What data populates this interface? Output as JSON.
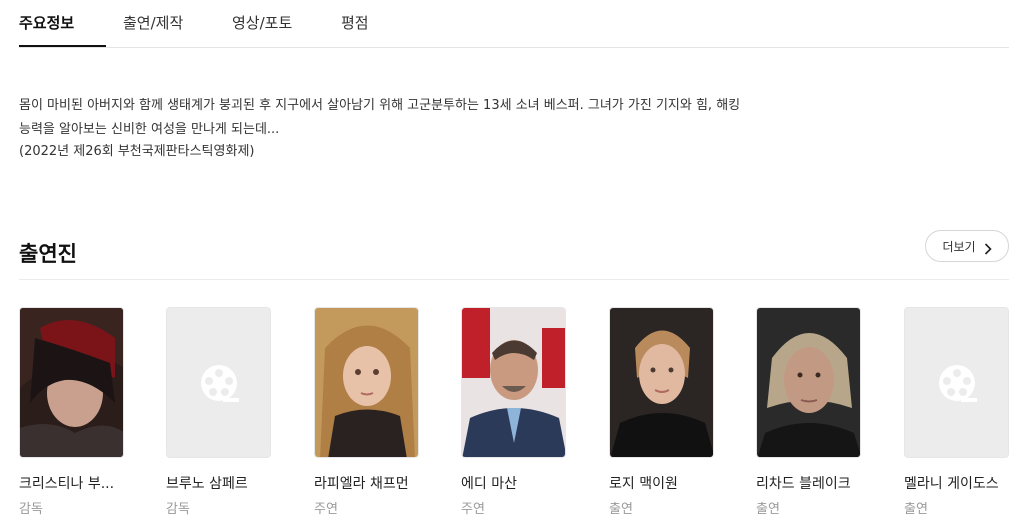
{
  "tabs": [
    {
      "label": "주요정보"
    },
    {
      "label": "출연/제작"
    },
    {
      "label": "영상/포토"
    },
    {
      "label": "평점"
    }
  ],
  "synopsis": {
    "text": "몸이 마비된 아버지와 함께 생태계가 붕괴된 후 지구에서 살아남기 위해 고군분투하는 13세 소녀 베스퍼. 그녀가 가진 기지와 힘, 해킹 능력을 알아보는 신비한 여성을 만나게 되는데...",
    "festival": "(2022년 제26회 부천국제판타스틱영화제)"
  },
  "cast_section": {
    "title": "출연진",
    "more_label": "더보기"
  },
  "cast": [
    {
      "name": "크리스티나 부...",
      "role": "감독",
      "photo": "person-photo"
    },
    {
      "name": "브루노 삼페르",
      "role": "감독",
      "photo": "placeholder-film-icon"
    },
    {
      "name": "라피엘라 채프먼",
      "role": "주연",
      "photo": "person-photo"
    },
    {
      "name": "에디 마산",
      "role": "주연",
      "photo": "person-photo"
    },
    {
      "name": "로지 맥이원",
      "role": "출연",
      "photo": "person-photo"
    },
    {
      "name": "리차드 블레이크",
      "role": "출연",
      "photo": "person-photo"
    },
    {
      "name": "멜라니 게이도스",
      "role": "출연",
      "photo": "placeholder-film-icon"
    }
  ]
}
